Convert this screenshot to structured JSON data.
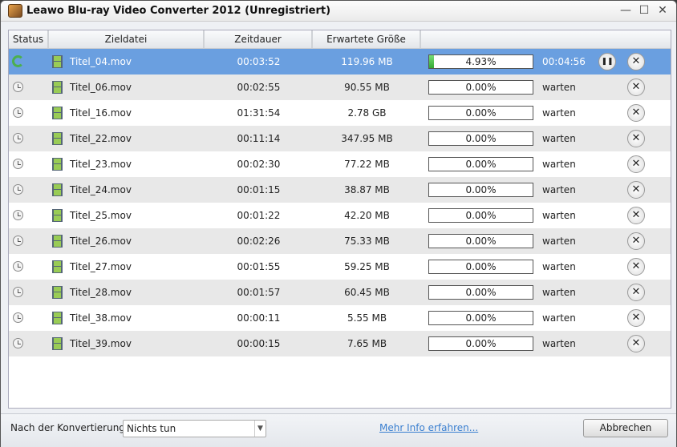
{
  "window": {
    "title": "Leawo Blu-ray Video Converter 2012 (Unregistriert)",
    "minimize": "—",
    "maximize": "☐",
    "close": "✕"
  },
  "columns": {
    "status": "Status",
    "file": "Zieldatei",
    "duration": "Zeitdauer",
    "size": "Erwartete Größe"
  },
  "rows": [
    {
      "file": "Titel_04.mov",
      "duration": "00:03:52",
      "size": "119.96 MB",
      "progress_text": "4.93%",
      "progress": 4.93,
      "state": "00:04:56",
      "active": true
    },
    {
      "file": "Titel_06.mov",
      "duration": "00:02:55",
      "size": "90.55 MB",
      "progress_text": "0.00%",
      "progress": 0,
      "state": "warten"
    },
    {
      "file": "Titel_16.mov",
      "duration": "01:31:54",
      "size": "2.78 GB",
      "progress_text": "0.00%",
      "progress": 0,
      "state": "warten"
    },
    {
      "file": "Titel_22.mov",
      "duration": "00:11:14",
      "size": "347.95 MB",
      "progress_text": "0.00%",
      "progress": 0,
      "state": "warten"
    },
    {
      "file": "Titel_23.mov",
      "duration": "00:02:30",
      "size": "77.22 MB",
      "progress_text": "0.00%",
      "progress": 0,
      "state": "warten"
    },
    {
      "file": "Titel_24.mov",
      "duration": "00:01:15",
      "size": "38.87 MB",
      "progress_text": "0.00%",
      "progress": 0,
      "state": "warten"
    },
    {
      "file": "Titel_25.mov",
      "duration": "00:01:22",
      "size": "42.20 MB",
      "progress_text": "0.00%",
      "progress": 0,
      "state": "warten"
    },
    {
      "file": "Titel_26.mov",
      "duration": "00:02:26",
      "size": "75.33 MB",
      "progress_text": "0.00%",
      "progress": 0,
      "state": "warten"
    },
    {
      "file": "Titel_27.mov",
      "duration": "00:01:55",
      "size": "59.25 MB",
      "progress_text": "0.00%",
      "progress": 0,
      "state": "warten"
    },
    {
      "file": "Titel_28.mov",
      "duration": "00:01:57",
      "size": "60.45 MB",
      "progress_text": "0.00%",
      "progress": 0,
      "state": "warten"
    },
    {
      "file": "Titel_38.mov",
      "duration": "00:00:11",
      "size": "5.55 MB",
      "progress_text": "0.00%",
      "progress": 0,
      "state": "warten"
    },
    {
      "file": "Titel_39.mov",
      "duration": "00:00:15",
      "size": "7.65 MB",
      "progress_text": "0.00%",
      "progress": 0,
      "state": "warten"
    }
  ],
  "footer": {
    "after_label": "Nach der Konvertierung:",
    "after_value": "Nichts tun",
    "more_info": "Mehr Info erfahren...",
    "cancel": "Abbrechen"
  },
  "icons": {
    "pause": "❚❚",
    "remove": "✕",
    "dropdown": "▼"
  }
}
